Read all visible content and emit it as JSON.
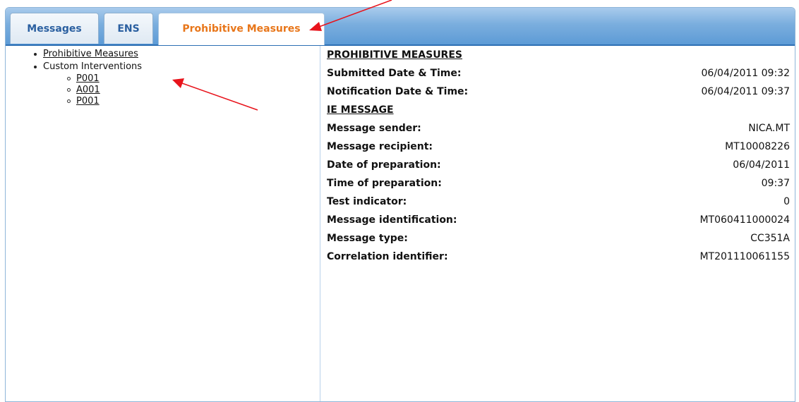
{
  "tabs": [
    {
      "label": "Messages",
      "active": false
    },
    {
      "label": "ENS",
      "active": false
    },
    {
      "label": "Prohibitive Measures",
      "active": true
    }
  ],
  "tree": {
    "item1": "Prohibitive Measures",
    "item2": "Custom Interventions",
    "children": [
      "P001",
      "A001",
      "P001"
    ]
  },
  "details": {
    "section1_title": "PROHIBITIVE MEASURES",
    "submitted_label": "Submitted Date & Time:",
    "submitted_value": "06/04/2011 09:32",
    "notification_label": "Notification Date & Time:",
    "notification_value": "06/04/2011 09:37",
    "section2_title": "IE MESSAGE",
    "rows": [
      {
        "label": "Message sender:",
        "value": "NICA.MT"
      },
      {
        "label": "Message recipient:",
        "value": "MT10008226"
      },
      {
        "label": "Date of preparation:",
        "value": "06/04/2011"
      },
      {
        "label": "Time of preparation:",
        "value": "09:37"
      },
      {
        "label": "Test indicator:",
        "value": "0"
      },
      {
        "label": "Message identification:",
        "value": "MT060411000024"
      },
      {
        "label": "Message type:",
        "value": "CC351A"
      },
      {
        "label": "Correlation identifier:",
        "value": "MT201110061155"
      }
    ]
  },
  "colors": {
    "accent_tab_text": "#e8761a",
    "tab_text": "#2a5fa0",
    "annotation_arrow": "#e8131b"
  }
}
